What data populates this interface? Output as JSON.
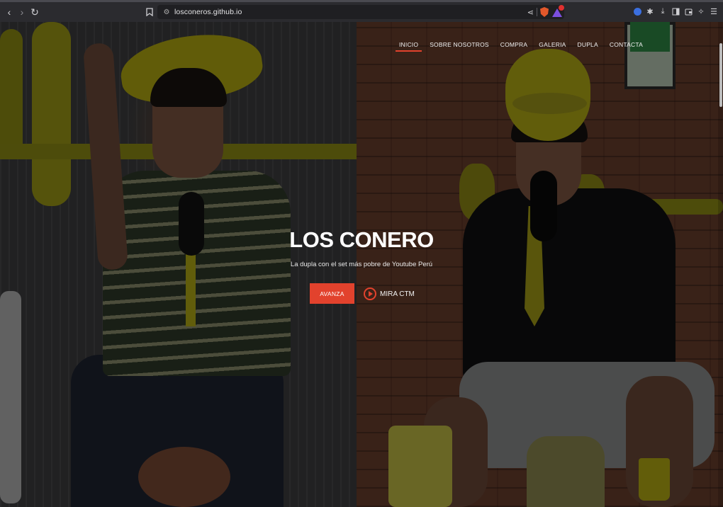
{
  "browser": {
    "url": "losconeros.github.io",
    "icons": {
      "back": "chevron-left-icon",
      "forward": "chevron-right-icon",
      "reload": "reload-icon",
      "bookmark": "bookmark-icon",
      "site_settings": "tune-icon",
      "share": "share-icon",
      "shield": "brave-shield-icon",
      "rewards": "brave-rewards-icon",
      "vpn": "vpn-icon",
      "extensions": "puzzle-icon",
      "downloads": "download-icon",
      "sidebar": "sidebar-icon",
      "wallet": "wallet-icon",
      "leo": "leo-ai-icon",
      "menu": "hamburger-menu-icon"
    }
  },
  "site": {
    "nav": [
      {
        "label": "INICIO",
        "active": true
      },
      {
        "label": "SOBRE NOSOTROS",
        "active": false
      },
      {
        "label": "COMPRA",
        "active": false
      },
      {
        "label": "GALERIA",
        "active": false
      },
      {
        "label": "DUPLA",
        "active": false
      },
      {
        "label": "CONTACTA",
        "active": false
      }
    ],
    "hero": {
      "title": "LOS CONERO",
      "subtitle": "La dupla con el set más pobre de Youtube Perú",
      "primary_button": "AVANZA",
      "secondary_button": "MIRA CTM"
    }
  },
  "colors": {
    "accent": "#e2422d",
    "chrome_bg": "#2b2b2f",
    "urlbar_bg": "#1f1f22"
  }
}
